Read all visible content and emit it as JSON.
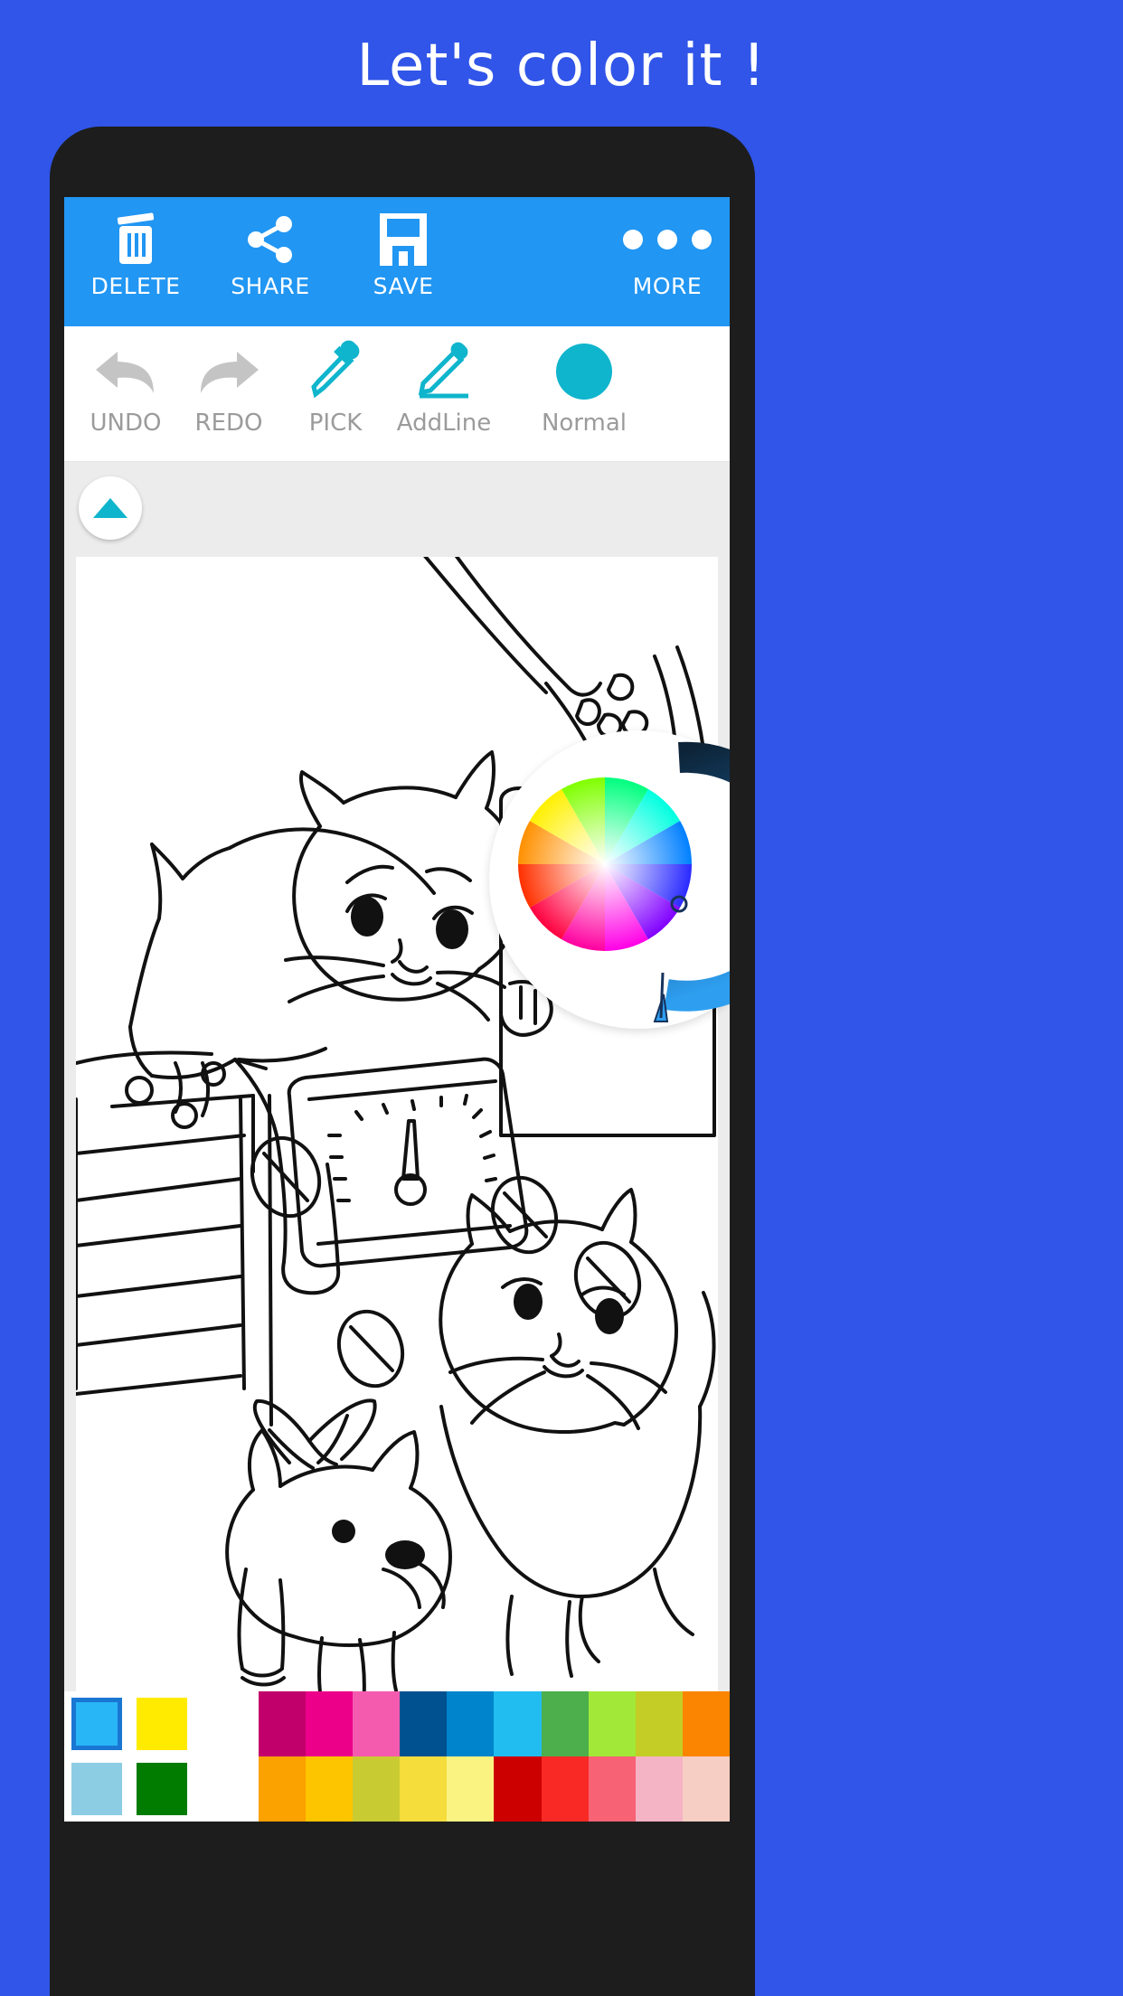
{
  "headline": "Let's color it !",
  "page": {
    "background_color": "#3055e8"
  },
  "actionbar": {
    "background_color": "#2196f3",
    "items": [
      {
        "label": "DELETE",
        "icon": "trash-icon"
      },
      {
        "label": "SHARE",
        "icon": "share-icon"
      },
      {
        "label": "SAVE",
        "icon": "floppy-save-icon"
      },
      {
        "label": "MORE",
        "icon": "overflow-dots-icon"
      }
    ]
  },
  "toolbar": {
    "items": [
      {
        "label": "UNDO",
        "icon": "undo-arrow-icon",
        "state": "disabled",
        "color": "#c4c4c4"
      },
      {
        "label": "REDO",
        "icon": "redo-arrow-icon",
        "state": "disabled",
        "color": "#c4c4c4"
      },
      {
        "label": "PICK",
        "icon": "eyedropper-icon",
        "state": "enabled",
        "color": "#0fb5cc"
      },
      {
        "label": "AddLine",
        "icon": "pencil-icon",
        "state": "enabled",
        "color": "#0fb5cc"
      },
      {
        "label": "Normal",
        "icon": "brush-mode-dot",
        "state": "enabled",
        "color": "#0fb5cc"
      }
    ]
  },
  "collapse_button": {
    "icon": "chevron-up-icon",
    "color": "#0fb5cc"
  },
  "color_picker": {
    "visible": true,
    "wheel": "hue-saturation-wheel",
    "brightness_ring": {
      "from": "#0d2438",
      "to": "#2e9ff0"
    },
    "selected_swatch_color": "#29b6f6"
  },
  "canvas": {
    "artwork": "line-art-coloring-page-kittens-puppy-scale-plant",
    "background_color": "#ffffff"
  },
  "palette": {
    "row1": [
      {
        "color": "#29b6f6",
        "selected": true,
        "padded": true
      },
      {
        "color": "#ffeb00",
        "selected": false,
        "padded": true
      },
      {
        "color": "#c2006b",
        "selected": false,
        "padded": false
      },
      {
        "color": "#ec0089",
        "selected": false,
        "padded": false
      },
      {
        "color": "#f45bae",
        "selected": false,
        "padded": false
      },
      {
        "color": "#00518f",
        "selected": false,
        "padded": false
      },
      {
        "color": "#0084cc",
        "selected": false,
        "padded": false
      },
      {
        "color": "#22bdf0",
        "selected": false,
        "padded": false
      },
      {
        "color": "#4caf4c",
        "selected": false,
        "padded": false
      },
      {
        "color": "#a1e838",
        "selected": false,
        "padded": false
      },
      {
        "color": "#c4cd25",
        "selected": false,
        "padded": false
      },
      {
        "color": "#fb8500",
        "selected": false,
        "padded": false
      }
    ],
    "row2": [
      {
        "color": "#8ccde4",
        "selected": false,
        "padded": true
      },
      {
        "color": "#017c00",
        "selected": false,
        "padded": true
      },
      {
        "color": "#fba100",
        "selected": false,
        "padded": false
      },
      {
        "color": "#fdc500",
        "selected": false,
        "padded": false
      },
      {
        "color": "#c9cb33",
        "selected": false,
        "padded": false
      },
      {
        "color": "#f5dd3c",
        "selected": false,
        "padded": false
      },
      {
        "color": "#fbf381",
        "selected": false,
        "padded": false
      },
      {
        "color": "#cd0000",
        "selected": false,
        "padded": false
      },
      {
        "color": "#f92a26",
        "selected": false,
        "padded": false
      },
      {
        "color": "#f76274",
        "selected": false,
        "padded": false
      },
      {
        "color": "#f5b3c6",
        "selected": false,
        "padded": false
      },
      {
        "color": "#f7cec3",
        "selected": false,
        "padded": false
      }
    ]
  }
}
